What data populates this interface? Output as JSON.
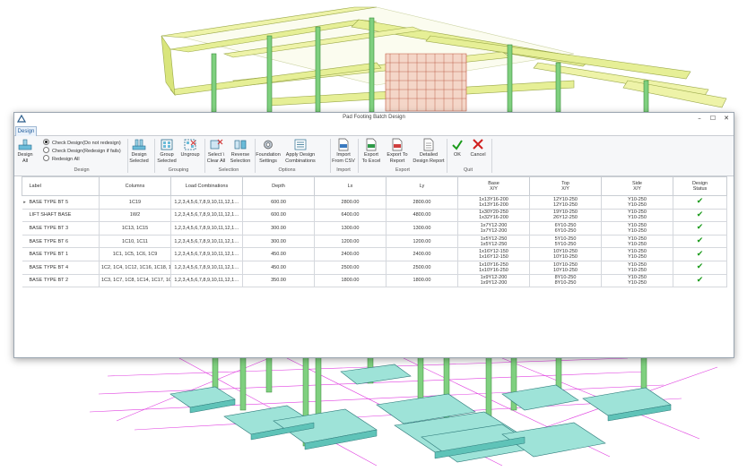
{
  "window": {
    "title": "Pad Footing Batch Design"
  },
  "tabs": [
    {
      "label": "Design"
    }
  ],
  "ribbon": {
    "design_all": "Design\nAll",
    "radios": [
      {
        "label": "Check Design(Do not redesign)",
        "selected": true
      },
      {
        "label": "Check Design(Redesign if fails)",
        "selected": false
      },
      {
        "label": "Redesign All",
        "selected": false
      }
    ],
    "buttons": {
      "design_selected": "Design\nSelected",
      "group_selected": "Group\nSelected",
      "ungroup": "Ungroup",
      "select_clear_all": "Select \\\nClear All",
      "reverse_selection": "Reverse\nSelection",
      "foundation_settings": "Foundation\nSettings",
      "apply_design_combinations": "Apply Design\nCombinations",
      "import_csv": "Import\nFrom CSV",
      "export_excel": "Export\nTo Excel",
      "export_report": "Export To\nReport",
      "detailed_report": "Detailed\nDesign Report",
      "ok": "OK",
      "cancel": "Cancel"
    },
    "groups": {
      "design": "Design",
      "grouping": "Grouping",
      "selection": "Selection",
      "options": "Options",
      "import": "Import",
      "export": "Export",
      "quit": "Quit"
    }
  },
  "grid": {
    "headers": {
      "label": "Label",
      "columns": "Columns",
      "load_combinations": "Load Combinations",
      "depth": "Depth",
      "lx": "Lx",
      "ly": "Ly",
      "base": "Base\nX/Y",
      "top": "Top\nX/Y",
      "side": "Side\nX/Y",
      "status": "Design\nStatus"
    },
    "current_row_marker": "▸",
    "status_mark": "✔",
    "rows": [
      {
        "label": "BASE TYPE BT 5",
        "columns": "1C19",
        "load": "1,2,3,4,5,6,7,8,9,10,11,12,1…",
        "depth": "600.00",
        "lx": "2800.00",
        "ly": "2800.00",
        "base": "1x13Y16-200\n1x13Y16-200",
        "top": "12Y10-250\n12Y10-250",
        "side": "Y10-250\nY10-250"
      },
      {
        "label": "LIFT SHAFT BASE",
        "columns": "1W2",
        "load": "1,2,3,4,5,6,7,8,9,10,11,12,1…",
        "depth": "600.00",
        "lx": "6400.00",
        "ly": "4800.00",
        "base": "1x30Y20-250\n1x32Y16-200",
        "top": "19Y10-250\n26Y12-250",
        "side": "Y10-250\nY10-250"
      },
      {
        "label": "BASE TYPE BT 3",
        "columns": "1C13, 1C15",
        "load": "1,2,3,4,5,6,7,8,9,10,11,12,1…",
        "depth": "300.00",
        "lx": "1300.00",
        "ly": "1300.00",
        "base": "1x7Y12-200\n1x7Y12-200",
        "top": "6Y10-250\n6Y10-250",
        "side": "Y10-250\nY10-250"
      },
      {
        "label": "BASE TYPE BT 6",
        "columns": "1C10, 1C11",
        "load": "1,2,3,4,5,6,7,8,9,10,11,12,1…",
        "depth": "300.00",
        "lx": "1200.00",
        "ly": "1200.00",
        "base": "1x5Y12-250\n1x5Y12-250",
        "top": "5Y10-250\n5Y10-250",
        "side": "Y10-250\nY10-250"
      },
      {
        "label": "BASE TYPE BT 1",
        "columns": "1C1, 1C5, 1C6, 1C9",
        "load": "1,2,3,4,5,6,7,8,9,10,11,12,1…",
        "depth": "450.00",
        "lx": "2400.00",
        "ly": "2400.00",
        "base": "1x16Y12-150\n1x16Y12-150",
        "top": "10Y10-250\n10Y10-250",
        "side": "Y10-250\nY10-250"
      },
      {
        "label": "BASE TYPE BT 4",
        "columns": "1C2, 1C4, 1C12, 1C16, 1C18, 1C…",
        "load": "1,2,3,4,5,6,7,8,9,10,11,12,1…",
        "depth": "450.00",
        "lx": "2500.00",
        "ly": "2500.00",
        "base": "1x10Y16-250\n1x10Y16-250",
        "top": "10Y10-250\n10Y10-250",
        "side": "Y10-250\nY10-250"
      },
      {
        "label": "BASE TYPE BT 2",
        "columns": "1C3, 1C7, 1C8, 1C14, 1C17, 1C21",
        "load": "1,2,3,4,5,6,7,8,9,10,11,12,1…",
        "depth": "350.00",
        "lx": "1800.00",
        "ly": "1800.00",
        "base": "1x9Y12-200\n1x9Y12-200",
        "top": "8Y10-250\n8Y10-250",
        "side": "Y10-250\nY10-250"
      }
    ]
  }
}
